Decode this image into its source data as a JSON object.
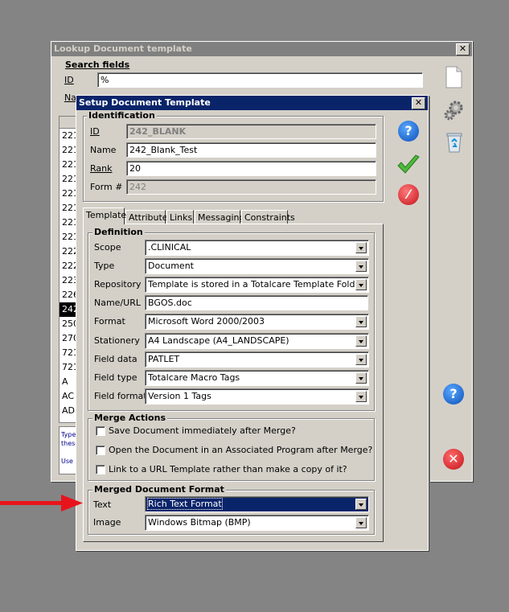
{
  "outer_window": {
    "title": "Lookup Document template",
    "search_group_title": "Search fields",
    "id_label": "ID",
    "id_value": "%",
    "name_label_partial": "Na",
    "list_rows": [
      "221",
      "221",
      "221",
      "221",
      "221",
      "221",
      "221",
      "221",
      "222",
      "222",
      "223",
      "226",
      "242",
      "250",
      "270",
      "721",
      "721",
      "A",
      "AC",
      "AD"
    ],
    "selected_row_index": 12,
    "help_text_partial": [
      "Type",
      "these",
      "",
      "Use"
    ]
  },
  "dialog": {
    "title": "Setup Document Template",
    "identification": {
      "title": "Identification",
      "id_label": "ID",
      "id_value": "242_BLANK",
      "name_label": "Name",
      "name_value": "242_Blank_Test",
      "rank_label": "Rank",
      "rank_value": "20",
      "form_label": "Form #",
      "form_value": "242"
    },
    "tabs": [
      "Template",
      "Attributes",
      "Links",
      "Messaging",
      "Constraints"
    ],
    "definition": {
      "title": "Definition",
      "rows": [
        {
          "label": "Scope",
          "value": ".CLINICAL",
          "combo": true
        },
        {
          "label": "Type",
          "value": "Document",
          "combo": true
        },
        {
          "label": "Repository",
          "value": "Template is stored in a Totalcare Template Folder",
          "combo": true
        },
        {
          "label": "Name/URL",
          "value": "BGOS.doc",
          "combo": false
        },
        {
          "label": "Format",
          "value": "Microsoft Word 2000/2003",
          "combo": true
        },
        {
          "label": "Stationery",
          "value": "A4 Landscape  (A4_LANDSCAPE)",
          "combo": true
        },
        {
          "label": "Field data",
          "value": "PATLET",
          "combo": true
        },
        {
          "label": "Field type",
          "value": "Totalcare Macro Tags",
          "combo": true
        },
        {
          "label": "Field format",
          "value": "Version 1 Tags",
          "combo": true
        }
      ]
    },
    "merge_actions": {
      "title": "Merge Actions",
      "items": [
        "Save Document immediately after Merge?",
        "Open the Document in an Associated Program after Merge?",
        "Link to a URL Template rather than make a copy of it?"
      ]
    },
    "merged_format": {
      "title": "Merged Document Format",
      "text_label": "Text",
      "text_value": "Rich Text Format",
      "image_label": "Image",
      "image_value": "Windows Bitmap (BMP)"
    }
  },
  "colors": {
    "desktop": "#848484",
    "active_title": "#0a246a",
    "arrow": "#e8141c",
    "highlight": "#0a246a"
  }
}
